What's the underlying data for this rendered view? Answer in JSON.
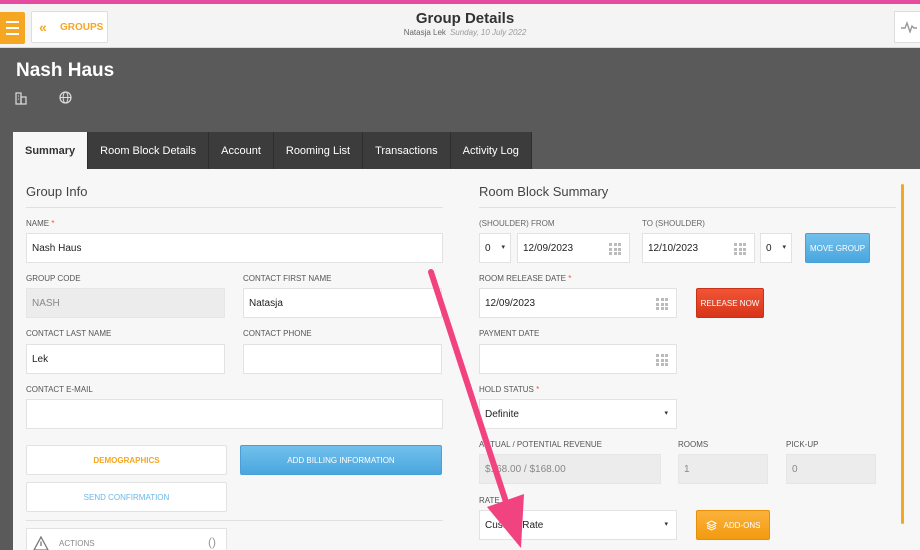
{
  "colors": {
    "accent": "#f5a623",
    "annotation": "#f0437f",
    "topstrip": "#e64ba0"
  },
  "topbar": {
    "back_label": "GROUPS",
    "back_icon": "double-chevron-left-icon",
    "title": "Group Details",
    "user": "Natasja Lek",
    "date": "Sunday, 10 July 2022",
    "menu_icon": "hamburger-icon",
    "activity_icon": "activity-pulse-icon"
  },
  "header": {
    "group_name": "Nash Haus",
    "icons": [
      "building-icon",
      "globe-icon"
    ]
  },
  "tabs": [
    {
      "label": "Summary",
      "active": true
    },
    {
      "label": "Room Block Details"
    },
    {
      "label": "Account"
    },
    {
      "label": "Rooming List"
    },
    {
      "label": "Transactions"
    },
    {
      "label": "Activity Log"
    }
  ],
  "group_info": {
    "title": "Group Info",
    "name_label": "NAME",
    "required_mark": "*",
    "name_value": "Nash Haus",
    "group_code_label": "GROUP CODE",
    "group_code_value": "NASH",
    "contact_first_label": "CONTACT FIRST NAME",
    "contact_first_value": "Natasja",
    "contact_last_label": "CONTACT LAST NAME",
    "contact_last_value": "Lek",
    "contact_phone_label": "CONTACT PHONE",
    "contact_phone_value": "",
    "contact_email_label": "CONTACT E-MAIL",
    "contact_email_value": "",
    "demographics_label": "DEMOGRAPHICS",
    "add_billing_label": "ADD BILLING INFORMATION",
    "send_confirmation_label": "SEND CONFIRMATION",
    "actions_label": "ACTIONS",
    "actions_count": "()"
  },
  "room_block": {
    "title": "Room Block Summary",
    "from_label": "(SHOULDER) FROM",
    "to_label": "TO (SHOULDER)",
    "from_shoulder": "0",
    "from_date": "12/09/2023",
    "to_date": "12/10/2023",
    "to_shoulder": "0",
    "move_group_label": "MOVE GROUP",
    "release_date_label": "ROOM RELEASE DATE",
    "release_date_value": "12/09/2023",
    "release_now_label": "RELEASE NOW",
    "payment_date_label": "PAYMENT DATE",
    "payment_date_value": "",
    "hold_status_label": "HOLD STATUS",
    "hold_status_value": "Definite",
    "revenue_label": "ACTUAL / POTENTIAL REVENUE",
    "revenue_value": "$168.00 / $168.00",
    "rooms_label": "ROOMS",
    "rooms_value": "1",
    "pickup_label": "PICK-UP",
    "pickup_value": "0",
    "rate_label": "RATE",
    "rate_value": "Custom Rate",
    "addons_label": "ADD-ONS",
    "addons_icon": "stack-icon"
  }
}
